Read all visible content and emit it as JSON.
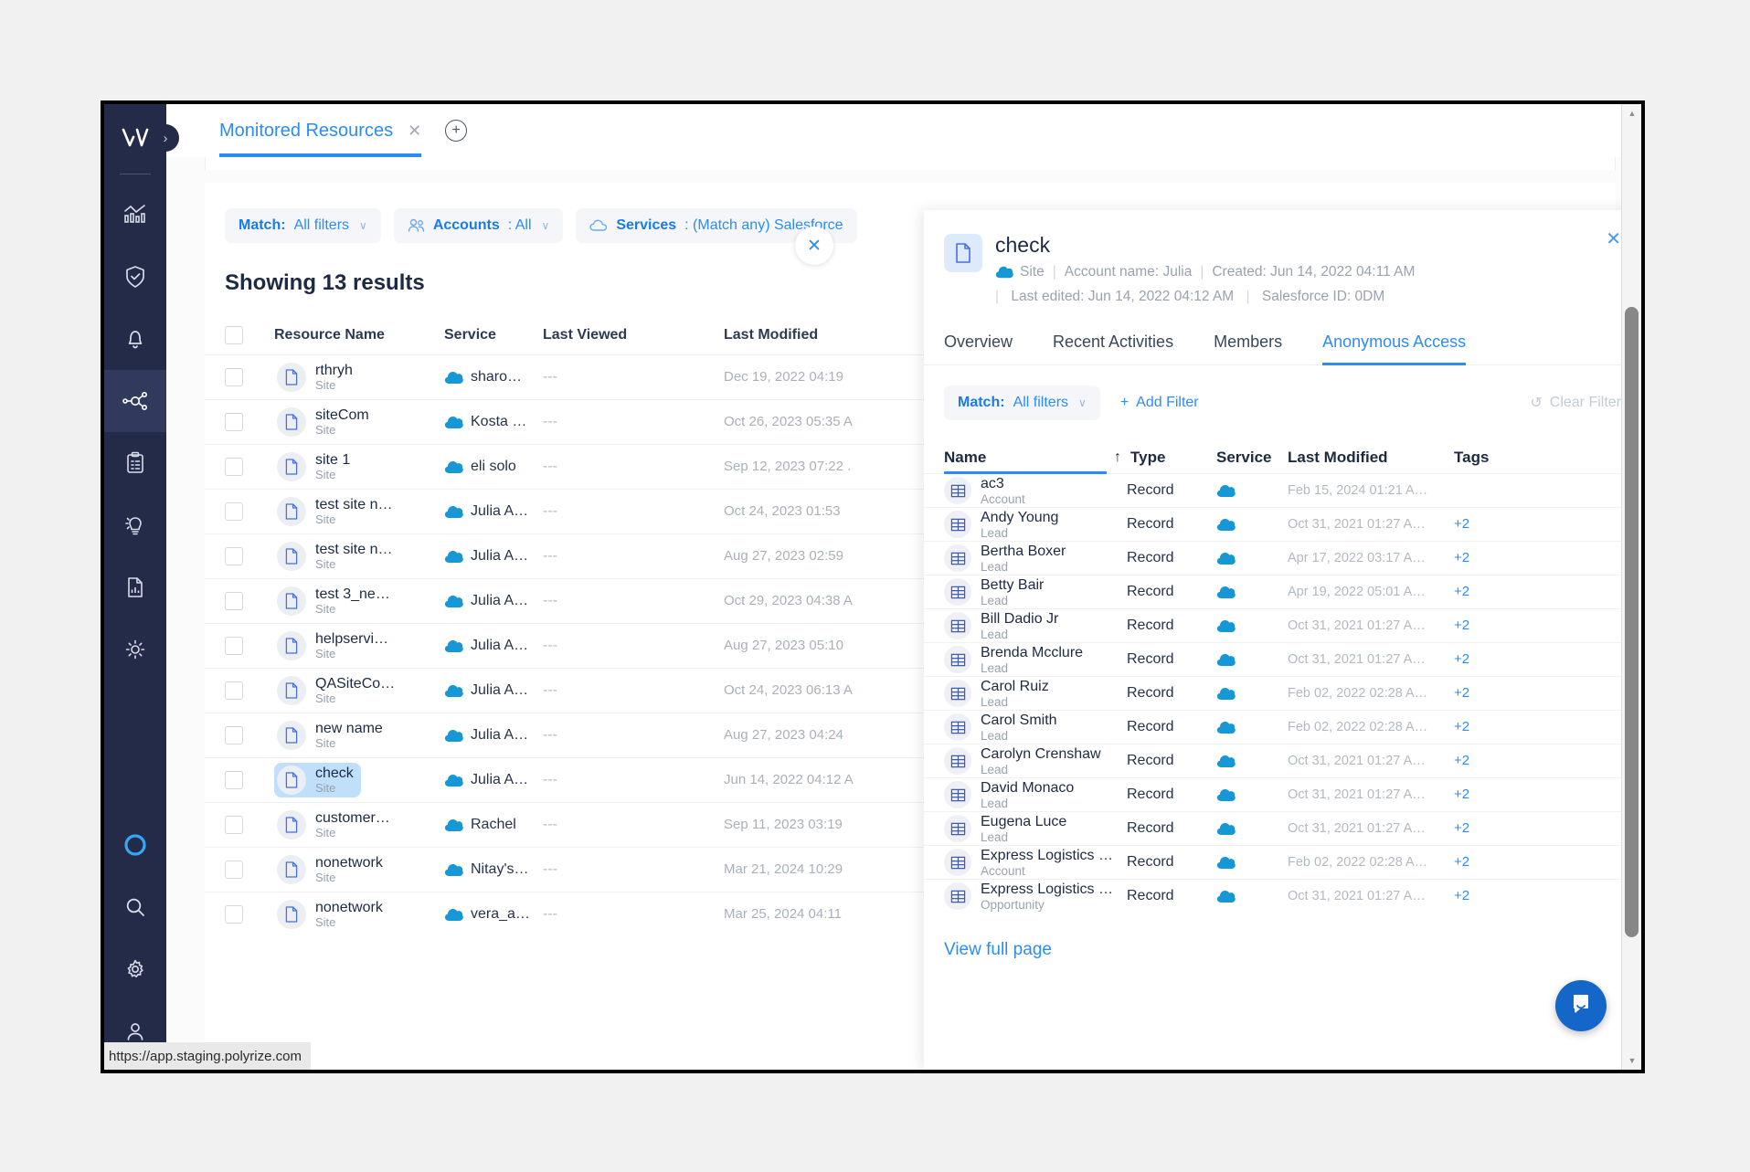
{
  "browser": {
    "status_url": "https://app.staging.polyrize.com"
  },
  "rail": {
    "logo": "polyrize-logo",
    "collapse_label": "›",
    "items": [
      {
        "name": "analytics-icon",
        "active": false
      },
      {
        "name": "shield-check-icon",
        "active": false
      },
      {
        "name": "bell-icon",
        "active": false
      },
      {
        "name": "network-graph-icon",
        "active": true
      },
      {
        "name": "clipboard-icon",
        "active": false
      },
      {
        "name": "idea-bulb-icon",
        "active": false
      },
      {
        "name": "report-file-icon",
        "active": false
      },
      {
        "name": "sun-icon",
        "active": false
      }
    ],
    "bottom_items": [
      {
        "name": "status-ring-icon"
      },
      {
        "name": "search-icon"
      },
      {
        "name": "gear-icon"
      },
      {
        "name": "user-icon"
      }
    ]
  },
  "tabs": {
    "active_tab": "Monitored Resources",
    "close_label": "✕",
    "add_label": "+"
  },
  "filters": {
    "match": {
      "label": "Match:",
      "value": "All filters",
      "caret": "∨"
    },
    "accounts": {
      "label": "Accounts",
      "value": "All",
      "caret": "∨"
    },
    "services": {
      "label": "Services",
      "value": "(Match any) Salesforce"
    }
  },
  "results": {
    "title": "Showing 13 results",
    "close_label": "✕",
    "columns": [
      "Resource Name",
      "Service",
      "Last Viewed",
      "Last Modified"
    ],
    "rows": [
      {
        "name": "rthryh",
        "sub": "Site",
        "service": "sharo…",
        "viewed": "---",
        "modified": "Dec 19, 2022 04:19",
        "selected": false
      },
      {
        "name": "siteCom",
        "sub": "Site",
        "service": "Kosta …",
        "viewed": "---",
        "modified": "Oct 26, 2023 05:35 A",
        "selected": false
      },
      {
        "name": "site 1",
        "sub": "Site",
        "service": "eli solo",
        "viewed": "---",
        "modified": "Sep 12, 2023 07:22 .",
        "selected": false
      },
      {
        "name": "test site n…",
        "sub": "Site",
        "service": "Julia A…",
        "viewed": "---",
        "modified": "Oct 24, 2023 01:53 ",
        "selected": false
      },
      {
        "name": "test site n…",
        "sub": "Site",
        "service": "Julia A…",
        "viewed": "---",
        "modified": "Aug 27, 2023 02:59 ",
        "selected": false
      },
      {
        "name": "test 3_ne…",
        "sub": "Site",
        "service": "Julia A…",
        "viewed": "---",
        "modified": "Oct 29, 2023 04:38 A",
        "selected": false
      },
      {
        "name": "helpservi…",
        "sub": "Site",
        "service": "Julia A…",
        "viewed": "---",
        "modified": "Aug 27, 2023 05:10 ",
        "selected": false
      },
      {
        "name": "QASiteCo…",
        "sub": "Site",
        "service": "Julia A…",
        "viewed": "---",
        "modified": "Oct 24, 2023 06:13 A",
        "selected": false
      },
      {
        "name": "new name",
        "sub": "Site",
        "service": "Julia A…",
        "viewed": "---",
        "modified": "Aug 27, 2023 04:24 ",
        "selected": false
      },
      {
        "name": "check",
        "sub": "Site",
        "service": "Julia A…",
        "viewed": "---",
        "modified": "Jun 14, 2022 04:12 A",
        "selected": true
      },
      {
        "name": "customer…",
        "sub": "Site",
        "service": "Rachel",
        "viewed": "---",
        "modified": "Sep 11, 2023 03:19 ",
        "selected": false
      },
      {
        "name": "nonetwork",
        "sub": "Site",
        "service": "Nitay's…",
        "viewed": "---",
        "modified": "Mar 21, 2024 10:29 ",
        "selected": false
      },
      {
        "name": "nonetwork",
        "sub": "Site",
        "service": "vera_a…",
        "viewed": "---",
        "modified": "Mar 25, 2024 04:11 ",
        "selected": false
      }
    ]
  },
  "panel": {
    "title": "check",
    "type_label": "Site",
    "meta_account": "Account name: Julia",
    "meta_created": "Created: Jun 14, 2022 04:11 AM",
    "meta_edited": "Last edited: Jun 14, 2022 04:12 AM",
    "meta_sfid": "Salesforce ID: 0DM",
    "close_label": "✕",
    "tabs": [
      {
        "label": "Overview",
        "active": false
      },
      {
        "label": "Recent Activities",
        "active": false
      },
      {
        "label": "Members",
        "active": false
      },
      {
        "label": "Anonymous Access",
        "active": true
      }
    ],
    "filters": {
      "match_label": "Match:",
      "match_value": "All filters",
      "match_caret": "∨",
      "add_filter": "Add Filter",
      "add_filter_icon": "+",
      "clear_filter": "Clear Filter",
      "clear_filter_icon": "↺"
    },
    "columns": [
      "Name",
      "Type",
      "Service",
      "Last Modified",
      "Tags"
    ],
    "sort_arrow": "↑",
    "rows": [
      {
        "name": "ac3",
        "sub": "Account",
        "type": "Record",
        "modified": "Feb 15, 2024 01:21 A…",
        "tags": ""
      },
      {
        "name": "Andy Young",
        "sub": "Lead",
        "type": "Record",
        "modified": "Oct 31, 2021 01:27 A…",
        "tags": "+2"
      },
      {
        "name": "Bertha Boxer",
        "sub": "Lead",
        "type": "Record",
        "modified": "Apr 17, 2022 03:17 A…",
        "tags": "+2"
      },
      {
        "name": "Betty Bair",
        "sub": "Lead",
        "type": "Record",
        "modified": "Apr 19, 2022 05:01 A…",
        "tags": "+2"
      },
      {
        "name": "Bill Dadio Jr",
        "sub": "Lead",
        "type": "Record",
        "modified": "Oct 31, 2021 01:27 A…",
        "tags": "+2"
      },
      {
        "name": "Brenda Mcclure",
        "sub": "Lead",
        "type": "Record",
        "modified": "Oct 31, 2021 01:27 A…",
        "tags": "+2"
      },
      {
        "name": "Carol Ruiz",
        "sub": "Lead",
        "type": "Record",
        "modified": "Feb 02, 2022 02:28 A…",
        "tags": "+2"
      },
      {
        "name": "Carol Smith",
        "sub": "Lead",
        "type": "Record",
        "modified": "Feb 02, 2022 02:28 A…",
        "tags": "+2"
      },
      {
        "name": "Carolyn Crenshaw",
        "sub": "Lead",
        "type": "Record",
        "modified": "Oct 31, 2021 01:27 A…",
        "tags": "+2"
      },
      {
        "name": "David Monaco",
        "sub": "Lead",
        "type": "Record",
        "modified": "Oct 31, 2021 01:27 A…",
        "tags": "+2"
      },
      {
        "name": "Eugena Luce",
        "sub": "Lead",
        "type": "Record",
        "modified": "Oct 31, 2021 01:27 A…",
        "tags": "+2"
      },
      {
        "name": "Express Logistics …",
        "sub": "Account",
        "type": "Record",
        "modified": "Feb 02, 2022 02:28 A…",
        "tags": "+2"
      },
      {
        "name": "Express Logistics …",
        "sub": "Opportunity",
        "type": "Record",
        "modified": "Oct 31, 2021 01:27 A…",
        "tags": "+2"
      }
    ],
    "view_full_page": "View full page"
  },
  "colors": {
    "accent_blue": "#2c8cf5",
    "rail_dark": "#232b49",
    "rail_active": "#313a5c",
    "selected_row": "#bfdffa",
    "text_dark": "#1d2a42",
    "text_muted": "#9aa2ad",
    "chat_blue": "#1467c8"
  }
}
